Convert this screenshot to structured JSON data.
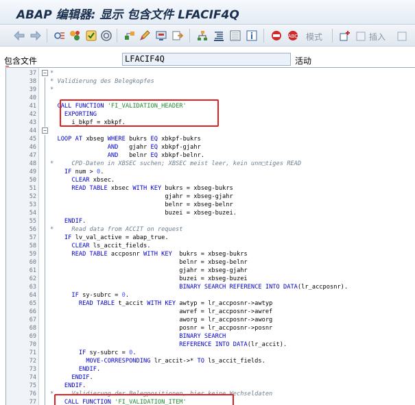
{
  "window": {
    "title": "ABAP 编辑器: 显示 包含文件 LFACIF4Q"
  },
  "toolbar": {
    "icons": [
      "back-arrow",
      "forward-arrow",
      "other-object",
      "change-display",
      "activate",
      "check",
      "where-used",
      "object-list",
      "display-object",
      "find",
      "replace",
      "hierarchy",
      "pretty-printer",
      "insert-statement",
      "info",
      "help",
      "abap-help",
      "mode",
      "add",
      "insert"
    ],
    "mode_label": "模式",
    "insert_label": "插入"
  },
  "fields": {
    "include_label": "包含文件",
    "include_value": "LFACIF4Q",
    "status_label": "活动"
  },
  "code": {
    "lines": [
      {
        "no": "37",
        "text": "*"
      },
      {
        "no": "38",
        "text": "* Validierung des Belegkopfes"
      },
      {
        "no": "39",
        "text": "*"
      },
      {
        "no": "40",
        "text": ""
      },
      {
        "no": "41",
        "text": "  CALL FUNCTION 'FI_VALIDATION_HEADER'"
      },
      {
        "no": "42",
        "text": "    EXPORTING"
      },
      {
        "no": "43",
        "text": "      i_bkpf = xbkpf."
      },
      {
        "no": "44",
        "text": ""
      },
      {
        "no": "45",
        "text": "  LOOP AT xbseg WHERE bukrs EQ xbkpf-bukrs"
      },
      {
        "no": "46",
        "text": "                AND   gjahr EQ xbkpf-gjahr"
      },
      {
        "no": "47",
        "text": "                AND   belnr EQ xbkpf-belnr."
      },
      {
        "no": "48",
        "text": "*     CPD-Daten in XBSEC suchen; XBSEC meist leer, kein unn□tiges READ"
      },
      {
        "no": "49",
        "text": "    IF num > 0."
      },
      {
        "no": "50",
        "text": "      CLEAR xbsec."
      },
      {
        "no": "51",
        "text": "      READ TABLE xbsec WITH KEY bukrs = xbseg-bukrs"
      },
      {
        "no": "52",
        "text": "                                gjahr = xbseg-gjahr"
      },
      {
        "no": "53",
        "text": "                                belnr = xbseg-belnr"
      },
      {
        "no": "54",
        "text": "                                buzei = xbseg-buzei."
      },
      {
        "no": "55",
        "text": "    ENDIF."
      },
      {
        "no": "56",
        "text": "*     Read data from ACCIT on request"
      },
      {
        "no": "57",
        "text": "    IF lv_val_active = abap_true."
      },
      {
        "no": "58",
        "text": "      CLEAR ls_accit_fields."
      },
      {
        "no": "59",
        "text": "      READ TABLE accposnr WITH KEY  bukrs = xbseg-bukrs"
      },
      {
        "no": "60",
        "text": "                                    belnr = xbseg-belnr"
      },
      {
        "no": "61",
        "text": "                                    gjahr = xbseg-gjahr"
      },
      {
        "no": "62",
        "text": "                                    buzei = xbseg-buzei"
      },
      {
        "no": "63",
        "text": "                                    BINARY SEARCH REFERENCE INTO DATA(lr_accposnr)."
      },
      {
        "no": "64",
        "text": "      IF sy-subrc = 0."
      },
      {
        "no": "65",
        "text": "        READ TABLE t_accit WITH KEY awtyp = lr_accposnr->awtyp"
      },
      {
        "no": "66",
        "text": "                                    awref = lr_accposnr->awref"
      },
      {
        "no": "67",
        "text": "                                    aworg = lr_accposnr->aworg"
      },
      {
        "no": "68",
        "text": "                                    posnr = lr_accposnr->posnr"
      },
      {
        "no": "69",
        "text": "                                    BINARY SEARCH"
      },
      {
        "no": "70",
        "text": "                                    REFERENCE INTO DATA(lr_accit)."
      },
      {
        "no": "71",
        "text": "        IF sy-subrc = 0."
      },
      {
        "no": "72",
        "text": "          MOVE-CORRESPONDING lr_accit->* TO ls_accit_fields."
      },
      {
        "no": "73",
        "text": "        ENDIF."
      },
      {
        "no": "74",
        "text": "      ENDIF."
      },
      {
        "no": "75",
        "text": "    ENDIF."
      },
      {
        "no": "76",
        "text": "*     Validierung der Belegpositionen, hier keine Wechseldaten"
      },
      {
        "no": "77",
        "text": "    CALL FUNCTION 'FI_VALIDATION_ITEM'"
      }
    ]
  }
}
